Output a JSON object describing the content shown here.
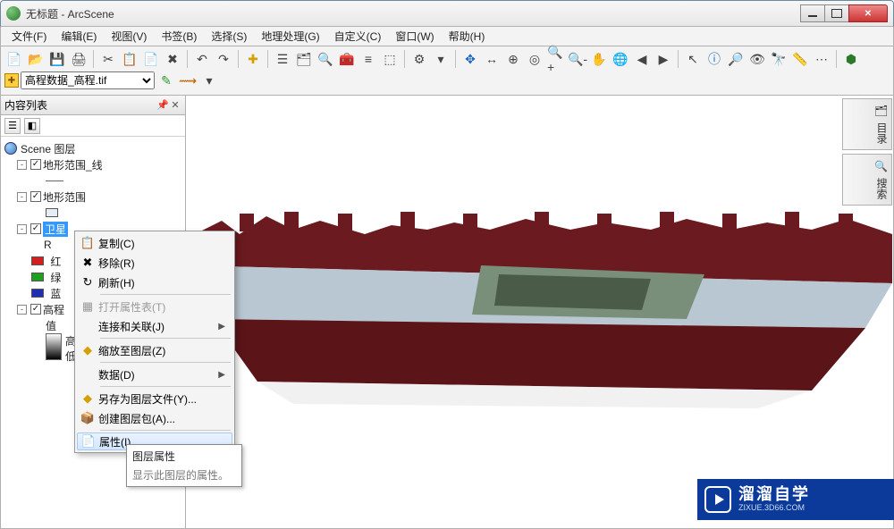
{
  "window": {
    "title": "无标题 - ArcScene"
  },
  "menubar": [
    "文件(F)",
    "编辑(E)",
    "视图(V)",
    "书签(B)",
    "选择(S)",
    "地理处理(G)",
    "自定义(C)",
    "窗口(W)",
    "帮助(H)"
  ],
  "layer_combo": {
    "selected": "高程数据_高程.tif"
  },
  "toc": {
    "title": "内容列表",
    "root": "Scene 图层",
    "nodes": [
      {
        "label": "地形范围_线",
        "checked": true,
        "exp": "-"
      },
      {
        "label": "地形范围",
        "checked": true,
        "exp": "-",
        "swatch": "#e6eef5"
      },
      {
        "label": "卫星",
        "checked": true,
        "exp": "-",
        "selected": true,
        "bands": [
          {
            "label": "红",
            "color": "#d02020"
          },
          {
            "label": "绿",
            "color": "#20a020"
          },
          {
            "label": "蓝",
            "color": "#2030b0"
          }
        ]
      },
      {
        "label": "高程",
        "checked": true,
        "exp": "-",
        "gradient": {
          "top": "值",
          "high": "高",
          "low": "低"
        }
      }
    ]
  },
  "context_menu": {
    "items": [
      {
        "icon": "copy-icon",
        "label": "复制(C)"
      },
      {
        "icon": "remove-icon",
        "label": "移除(R)"
      },
      {
        "icon": "refresh-icon",
        "label": "刷新(H)"
      },
      {
        "sep": true
      },
      {
        "icon": "table-icon",
        "label": "打开属性表(T)",
        "disabled": true
      },
      {
        "icon": "join-icon",
        "label": "连接和关联(J)",
        "submenu": true
      },
      {
        "sep": true
      },
      {
        "icon": "zoom-layer-icon",
        "label": "缩放至图层(Z)"
      },
      {
        "sep": true
      },
      {
        "icon": "data-icon",
        "label": "数据(D)",
        "submenu": true
      },
      {
        "sep": true
      },
      {
        "icon": "save-layer-icon",
        "label": "另存为图层文件(Y)..."
      },
      {
        "icon": "package-icon",
        "label": "创建图层包(A)..."
      },
      {
        "sep": true
      },
      {
        "icon": "properties-icon",
        "label": "属性(I)...",
        "highlight": true
      }
    ]
  },
  "tooltip": {
    "title": "图层属性",
    "desc": "显示此图层的属性。"
  },
  "side_tabs": [
    "目录",
    "搜索"
  ],
  "watermark": {
    "brand": "溜溜自学",
    "url": "ZIXUE.3D66.COM"
  }
}
